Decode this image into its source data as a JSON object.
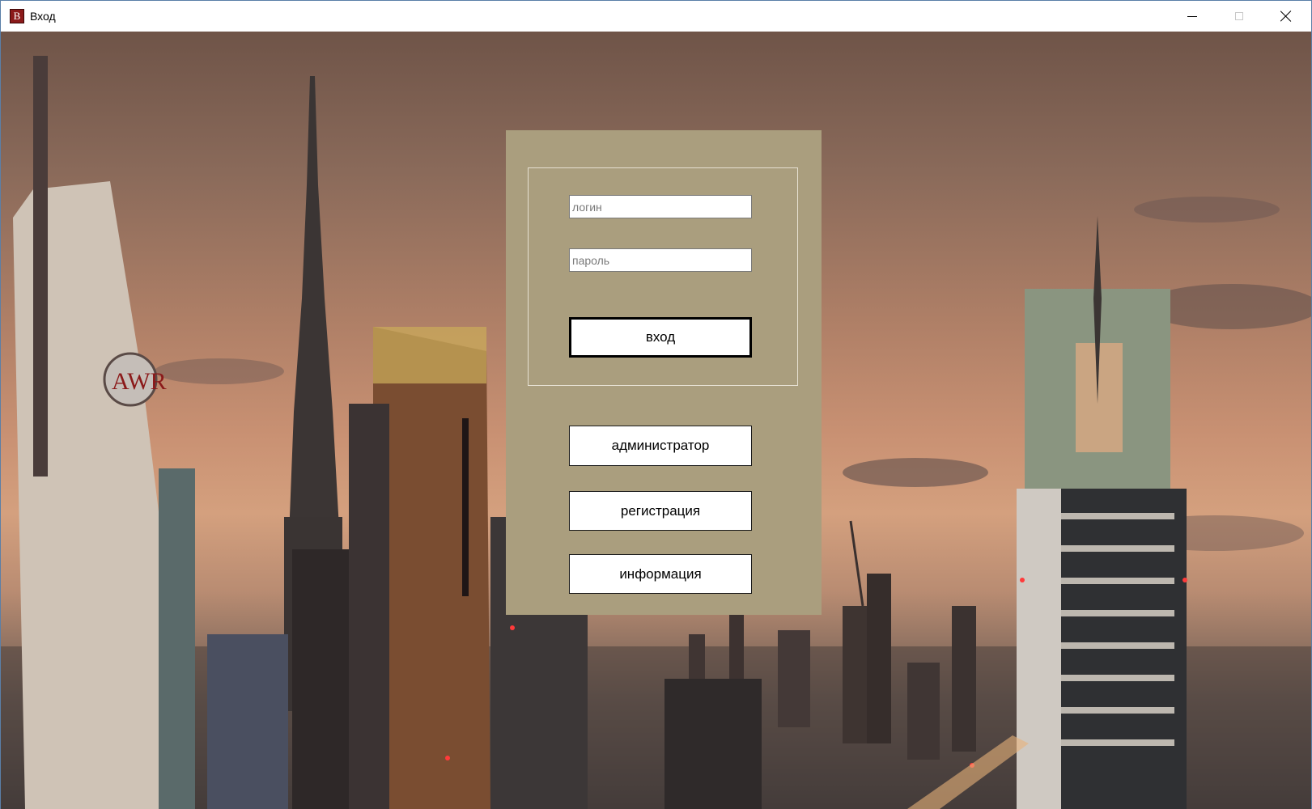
{
  "window": {
    "title": "Вход",
    "app_icon_letter": "B"
  },
  "login_form": {
    "login_placeholder": "логин",
    "password_placeholder": "пароль",
    "login_value": "",
    "password_value": "",
    "enter_button": "вход"
  },
  "actions": {
    "admin_button": "администратор",
    "register_button": "регистрация",
    "info_button": "информация"
  },
  "colors": {
    "panel_background": "#aa9e7e",
    "app_icon": "#8b1a1a"
  }
}
